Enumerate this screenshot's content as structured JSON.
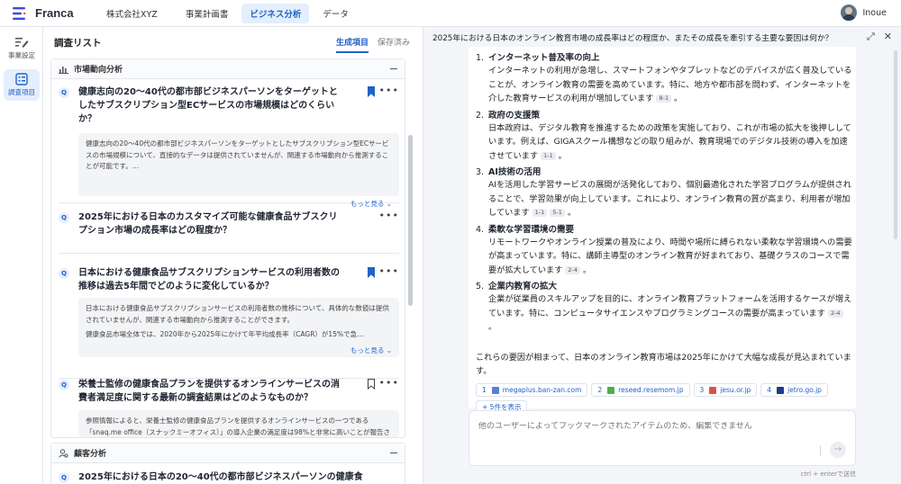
{
  "app": {
    "name": "Franca"
  },
  "header": {
    "company": "株式会社XYZ",
    "tabs": [
      {
        "label": "事業計画書"
      },
      {
        "label": "ビジネス分析"
      },
      {
        "label": "データ"
      }
    ],
    "active_tab": "ビジネス分析",
    "user_name": "Inoue"
  },
  "rail": {
    "items": [
      {
        "label": "事業設定",
        "icon": "edit-settings-icon"
      },
      {
        "label": "調査項目",
        "icon": "survey-list-icon"
      }
    ]
  },
  "research": {
    "title": "調査リスト",
    "tabs": [
      {
        "label": "生成項目"
      },
      {
        "label": "保存済み"
      }
    ],
    "sections": [
      {
        "title": "市場動向分析",
        "icon": "bar-chart-icon",
        "items": [
          {
            "badge": "Q",
            "title": "健康志向の20〜40代の都市部ビジネスパーソンをターゲットとしたサブスクリプション型ECサービスの市場規模はどのくらいか？",
            "bookmarked": true,
            "summary": [
              "健康志向の20〜40代の都市部ビジネスパーソンをターゲットとしたサブスクリプション型ECサービスの市場規模について、直接的なデータは提供されていませんが、関連する市場動向から推測することが可能です。…"
            ],
            "show_more": "もっと見る"
          },
          {
            "badge": "Q",
            "title": "2025年における日本のカスタマイズ可能な健康食品サブスクリプション市場の成長率はどの程度か？",
            "bookmarked": false
          },
          {
            "badge": "Q",
            "title": "日本における健康食品サブスクリプションサービスの利用者数の推移は過去5年間でどのように変化しているか？",
            "bookmarked": true,
            "summary": [
              "日本における健康食品サブスクリプションサービスの利用者数の推移について、具体的な数値は提供されていませんが、関連する市場動向から推測することができます。",
              "健康食品市場全体では、2020年から2025年にかけて年平均成長率（CAGR）が15%で急…"
            ],
            "show_more": "もっと見る"
          },
          {
            "badge": "Q",
            "title": "栄養士監修の健康食品プランを提供するオンラインサービスの消費者満足度に関する最新の調査結果はどのようなものか？",
            "bookmarked": false,
            "summary": [
              "参照情報によると、栄養士監修の健康食品プランを提供するオンラインサービスの一つである「snaq.me office（スナックミーオフィス）」の導入企業の満足度は98%と非常に高いことが報告されています。"
            ]
          }
        ]
      },
      {
        "title": "顧客分析",
        "icon": "customer-icon",
        "items": [
          {
            "badge": "Q",
            "title": "2025年における日本の20〜40代の都市部ビジネスパーソンの健康食"
          }
        ]
      }
    ]
  },
  "chat": {
    "question": "2025年における日本のオンライン教育市場の成長率はどの程度か、またその成長を牽引する主要な要因は何か？",
    "reasons": [
      {
        "num": "1.",
        "title": "インターネット普及率の向上",
        "body": "インターネットの利用が急増し、スマートフォンやタブレットなどのデバイスが広く普及していることが、オンライン教育の需要を高めています。特に、地方や都市部を問わず、インターネットを介した教育サービスの利用が増加しています",
        "cites": [
          "8-1"
        ]
      },
      {
        "num": "2.",
        "title": "政府の支援策",
        "body": "日本政府は、デジタル教育を推進するための政策を実施しており、これが市場の拡大を後押ししています。例えば、GIGAスクール構想などの取り組みが、教育現場でのデジタル技術の導入を加速させています",
        "cites": [
          "1-1"
        ]
      },
      {
        "num": "3.",
        "title": "AI技術の活用",
        "body": "AIを活用した学習サービスの展開が活発化しており、個別最適化された学習プログラムが提供されることで、学習効果が向上しています。これにより、オンライン教育の質が高まり、利用者が増加しています",
        "cites": [
          "1-1",
          "5-1"
        ]
      },
      {
        "num": "4.",
        "title": "柔軟な学習環境の需要",
        "body": "リモートワークやオンライン授業の普及により、時間や場所に縛られない柔軟な学習環境への需要が高まっています。特に、講師主導型のオンライン教育が好まれており、基礎クラスのコースで需要が拡大しています",
        "cites": [
          "2-4"
        ]
      },
      {
        "num": "5.",
        "title": "企業内教育の拡大",
        "body": "企業が従業員のスキルアップを目的に、オンライン教育プラットフォームを活用するケースが増えています。特に、コンピュータサイエンスやプログラミングコースの需要が高まっています",
        "cites": [
          "2-4"
        ]
      }
    ],
    "conclusion": "これらの要因が相まって、日本のオンライン教育市場は2025年にかけて大幅な成長が見込まれています。",
    "sources": [
      {
        "idx": "1",
        "domain": "megaplus.ban-zan.com",
        "color": "#5a7fd6"
      },
      {
        "idx": "2",
        "domain": "reseed.resemom.jp",
        "color": "#4caf50"
      },
      {
        "idx": "3",
        "domain": "jesu.or.jp",
        "color": "#d9534f"
      },
      {
        "idx": "4",
        "domain": "jetro.go.jp",
        "color": "#1f3a8a"
      }
    ],
    "more_sources": "+ 5件を表示",
    "composer_placeholder": "他のユーザーによってブックマークされたアイテムのため、編集できません",
    "hint": "ctrl + enterで送信"
  },
  "colors": {
    "accent": "#2163c8",
    "accent_bg": "#e4eefc"
  }
}
